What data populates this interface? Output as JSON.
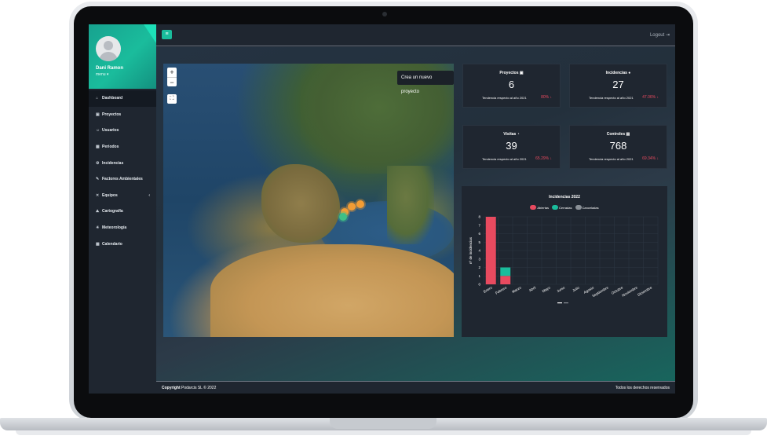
{
  "user": {
    "name": "Dani Ramon",
    "menu": "menu ▾"
  },
  "sidebar": {
    "items": [
      {
        "icon": "⌂",
        "label": "Dashboard",
        "active": true
      },
      {
        "icon": "▣",
        "label": "Proyectos"
      },
      {
        "icon": "☺",
        "label": "Usuarios"
      },
      {
        "icon": "▦",
        "label": "Periodos"
      },
      {
        "icon": "⚙",
        "label": "Incidencias"
      },
      {
        "icon": "✎",
        "label": "Factores Ambientales"
      },
      {
        "icon": "✕",
        "label": "Equipos",
        "arrow": "‹"
      },
      {
        "icon": "⛰",
        "label": "Cartografía"
      },
      {
        "icon": "☀",
        "label": "Meteorología"
      },
      {
        "icon": "▦",
        "label": "Calendario"
      }
    ]
  },
  "topbar": {
    "menu_icon": "≡",
    "logout": "Logout ⇥"
  },
  "map": {
    "zoom_in": "+",
    "zoom_out": "−",
    "fullscreen": "⛶",
    "new_project": "Crea un nuevo proyecto"
  },
  "stats": [
    {
      "title": "Proyectos ▣",
      "value": "6",
      "trend": "Tendencia respecto al año 2021",
      "pct": "80% ↓"
    },
    {
      "title": "Incidencias ●",
      "value": "27",
      "trend": "Tendencia respecto al año 2021",
      "pct": "47.06% ↓"
    },
    {
      "title": "Visitas ◔",
      "value": "39",
      "trend": "Tendencia respecto al año 2021",
      "pct": "65.29% ↓"
    },
    {
      "title": "Controles ▤",
      "value": "768",
      "trend": "Tendencia respecto al año 2021",
      "pct": "69.34% ↓"
    }
  ],
  "chart_data": {
    "type": "bar",
    "title": "Incidencias 2022",
    "ylabel": "nº de incidencias",
    "xlabel": "",
    "categories": [
      "Enero",
      "Febrero",
      "Marzo",
      "Abril",
      "Mayo",
      "Junio",
      "Julio",
      "Agosto",
      "Septiembre",
      "Octubre",
      "Noviembre",
      "Diciembre"
    ],
    "series": [
      {
        "name": "Abiertas",
        "color": "#e84a5f",
        "values": [
          8,
          1,
          0,
          0,
          0,
          0,
          0,
          0,
          0,
          0,
          0,
          0
        ]
      },
      {
        "name": "Cerradas",
        "color": "#1abc9c",
        "values": [
          0,
          1,
          0,
          0,
          0,
          0,
          0,
          0,
          0,
          0,
          0,
          0
        ]
      },
      {
        "name": "Canceladas",
        "color": "#8a9097",
        "values": [
          0,
          0,
          0,
          0,
          0,
          0,
          0,
          0,
          0,
          0,
          0,
          0
        ]
      }
    ],
    "stacked": true,
    "ylim": [
      0,
      8
    ],
    "yticks": [
      0,
      1,
      2,
      3,
      4,
      5,
      6,
      7,
      8
    ],
    "grid": true
  },
  "footer": {
    "copyright_bold": "Copyright",
    "copyright_rest": " Podarcis SL © 2022",
    "rights": "Todos los derechos reservados"
  }
}
